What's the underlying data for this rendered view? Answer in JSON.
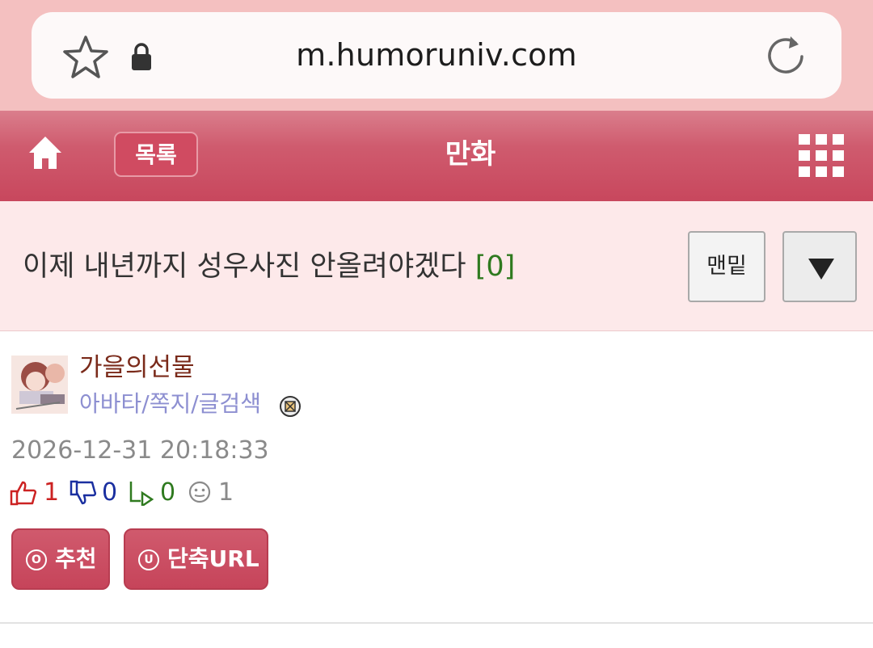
{
  "browser": {
    "url": "m.humoruniv.com",
    "star_icon": "star-icon",
    "lock_icon": "lock-icon",
    "reload_icon": "reload-icon"
  },
  "nav": {
    "home_icon": "home-icon",
    "list_label": "목록",
    "title": "만화",
    "menu_icon": "grid-menu-icon"
  },
  "post": {
    "title": "이제 내년까지 성우사진 안올려야겠다",
    "comment_count": "[0]",
    "bottom_label": "맨밑",
    "down_icon": "triangle-down-icon"
  },
  "author": {
    "name": "가을의선물",
    "links": "아바타/쪽지/글검색",
    "date": "2026-12-31 20:18:33"
  },
  "stats": {
    "likes": "1",
    "dislikes": "0",
    "shares": "0",
    "views": "1"
  },
  "actions": {
    "recommend_label": "추천",
    "recommend_icon_char": "O",
    "shorturl_label": "단축URL",
    "shorturl_icon_char": "U"
  },
  "colors": {
    "nav_bg": "#c8475d",
    "title_bg": "#fde9ea",
    "comment_count": "#2f7a1f",
    "author_name": "#7a2a1a",
    "author_links": "#8d8fd1",
    "likes": "#cc2222",
    "dislikes": "#1a2fa0",
    "shares": "#2f7a1f",
    "views": "#8a8a8a"
  }
}
